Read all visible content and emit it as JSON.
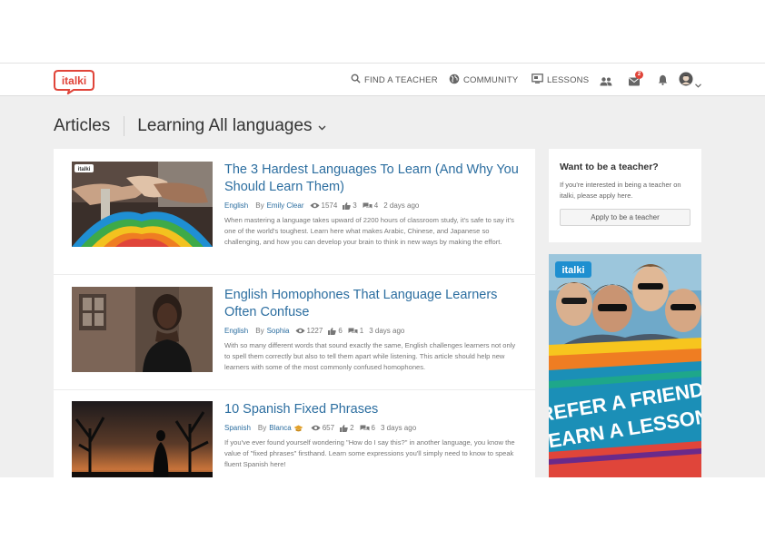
{
  "brand": {
    "logo_text": "italki",
    "accent": "#e0453a",
    "link_color": "#2c6ea0"
  },
  "nav": {
    "find_teacher": "FIND A TEACHER",
    "community": "COMMUNITY",
    "lessons": "LESSONS",
    "messages_badge": "2",
    "icons": [
      "search-icon",
      "globe-icon",
      "lessons-icon",
      "people-icon",
      "mail-icon",
      "bell-icon",
      "avatar",
      "chevron-down-icon"
    ]
  },
  "page": {
    "title": "Articles",
    "filter_label": "Learning All languages"
  },
  "articles": [
    {
      "title": "The 3 Hardest Languages To Learn (And Why You Should Learn Them)",
      "language": "English",
      "by": "By",
      "author": "Emily Clear",
      "views": "1574",
      "likes": "3",
      "comments": "4",
      "time": "2 days ago",
      "excerpt": "When mastering a language takes upward of 2200 hours of classroom study, it's safe to say it's one of the world's toughest. Learn here what makes Arabic, Chinese, and Japanese so challenging, and how you can develop your brain to think in new ways by making the effort.",
      "thumb_tag": "italki"
    },
    {
      "title": "English Homophones That Language Learners Often Confuse",
      "language": "English",
      "by": "By",
      "author": "Sophia",
      "views": "1227",
      "likes": "6",
      "comments": "1",
      "time": "3 days ago",
      "excerpt": "With so many different words that sound exactly the same, English challenges learners not only to spell them correctly but also to tell them apart while listening. This article should help new learners with some of the most commonly confused homophones."
    },
    {
      "title": "10 Spanish Fixed Phrases",
      "language": "Spanish",
      "by": "By",
      "author": "Blanca",
      "views": "657",
      "likes": "2",
      "comments": "6",
      "time": "3 days ago",
      "excerpt": "If you've ever found yourself wondering \"How do I say this?\" in another language, you know the value of \"fixed phrases\" firsthand. Learn some expressions you'll simply need to know to speak fluent Spanish here!"
    }
  ],
  "sidebar": {
    "teacher_title": "Want to be a teacher?",
    "teacher_text": "If you're interested in being a teacher on italki, please apply here.",
    "apply_button": "Apply to be a teacher",
    "ad_logo": "italki",
    "ad_line1": "REFER A FRIEND,",
    "ad_line2": "EARN A LESSON"
  }
}
